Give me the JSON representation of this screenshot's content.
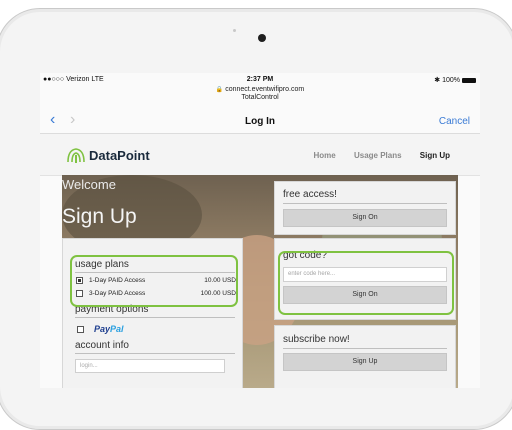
{
  "status_bar": {
    "carrier": "●●○○○ Verizon  LTE",
    "time": "2:37 PM",
    "battery": "✱ 100%"
  },
  "address": {
    "domain": "connect.eventwifipro.com",
    "page_name": "TotalControl"
  },
  "nav": {
    "title": "Log In",
    "cancel": "Cancel"
  },
  "site": {
    "brand": "DataPoint",
    "menu": [
      "Home",
      "Usage Plans",
      "Sign Up"
    ]
  },
  "hero": {
    "welcome": "Welcome",
    "heading": "Sign Up"
  },
  "usage_plans": {
    "heading": "usage plans",
    "plans": [
      {
        "name": "1-Day PAID Access",
        "price": "10.00 USD",
        "checked": true
      },
      {
        "name": "3-Day PAID Access",
        "price": "100.00 USD",
        "checked": false
      }
    ]
  },
  "payment": {
    "heading": "payment options",
    "paypal_a": "Pay",
    "paypal_b": "Pal"
  },
  "account": {
    "heading": "account info",
    "login_placeholder": "login..."
  },
  "free_access": {
    "heading": "free access!",
    "button": "Sign On"
  },
  "got_code": {
    "heading": "got code?",
    "placeholder": "enter code here...",
    "button": "Sign On"
  },
  "subscribe": {
    "heading": "subscribe now!",
    "button": "Sign Up"
  },
  "colors": {
    "highlight": "#7fc241",
    "ios_blue": "#3a7bd5",
    "paypal_dark": "#1f3f8f",
    "paypal_light": "#2aa0e0"
  }
}
